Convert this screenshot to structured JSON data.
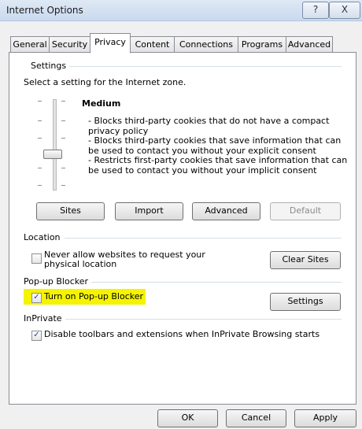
{
  "window": {
    "title": "Internet Options",
    "help_glyph": "?",
    "close_glyph": "X"
  },
  "tabs": [
    "General",
    "Security",
    "Privacy",
    "Content",
    "Connections",
    "Programs",
    "Advanced"
  ],
  "active_tab": "Privacy",
  "settings": {
    "group_label": "Settings",
    "prompt": "Select a setting for the Internet zone.",
    "level": "Medium",
    "description": "- Blocks third-party cookies that do not have a compact\n  privacy policy\n- Blocks third-party cookies that save information that can\n  be used to contact you without your explicit consent\n- Restricts first-party cookies that save information that can\n  be used to contact you without your implicit consent",
    "buttons": {
      "sites": "Sites",
      "import": "Import",
      "advanced": "Advanced",
      "default": "Default"
    }
  },
  "location": {
    "group_label": "Location",
    "checkbox_label_line1": "Never allow websites to request your",
    "checkbox_label_line2": "physical location",
    "checked": false,
    "clear_sites": "Clear Sites"
  },
  "popup": {
    "group_label": "Pop-up Blocker",
    "checkbox_label": "Turn on Pop-up Blocker",
    "checked": true,
    "settings_button": "Settings"
  },
  "inprivate": {
    "group_label": "InPrivate",
    "checkbox_label": "Disable toolbars and extensions when InPrivate Browsing starts",
    "checked": true
  },
  "footer": {
    "ok": "OK",
    "cancel": "Cancel",
    "apply": "Apply"
  },
  "colors": {
    "highlight": "#f5f300",
    "titlebar": "#c9d9ee"
  }
}
